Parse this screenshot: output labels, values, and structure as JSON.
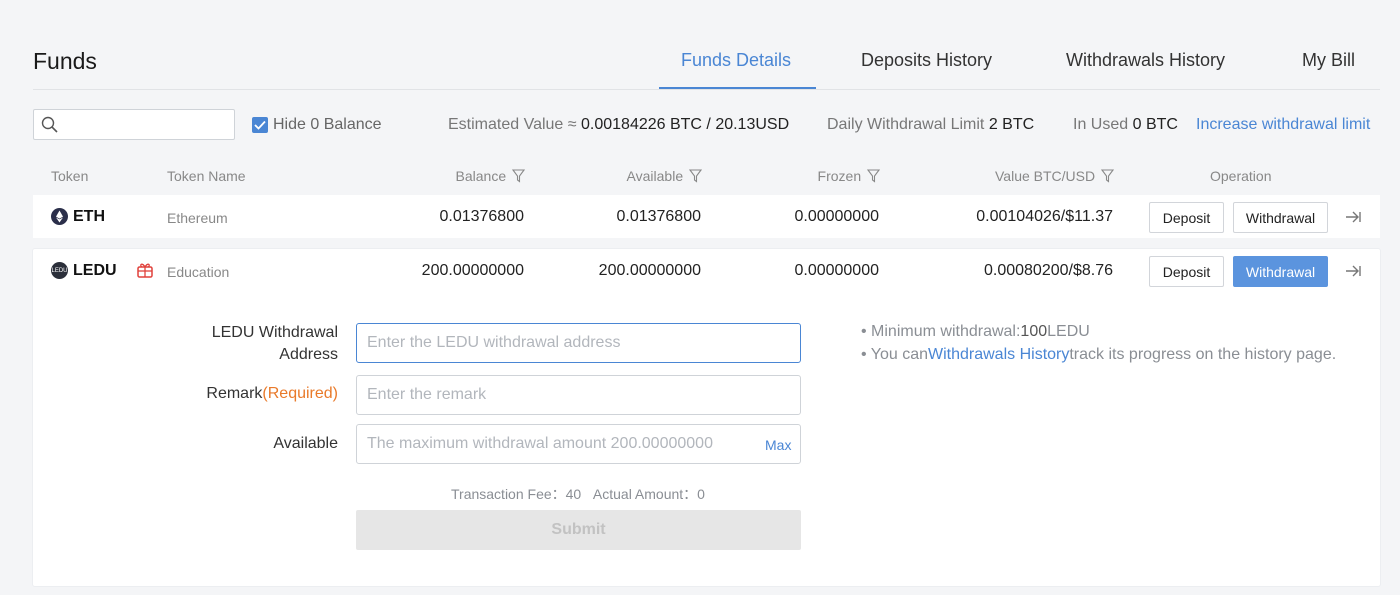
{
  "page": {
    "title": "Funds"
  },
  "tabs": [
    {
      "label": "Funds Details",
      "active": true
    },
    {
      "label": "Deposits History",
      "active": false
    },
    {
      "label": "Withdrawals History",
      "active": false
    },
    {
      "label": "My Bill",
      "active": false
    }
  ],
  "toolbar": {
    "search_value": "",
    "hide_zero_label": "Hide 0 Balance",
    "hide_zero_checked": true,
    "estimated_label": "Estimated Value ≈",
    "estimated_value": "0.00184226 BTC / 20.13USD",
    "daily_limit_label": "Daily Withdrawal Limit",
    "daily_limit_value": "2 BTC",
    "in_used_label": "In Used",
    "in_used_value": "0 BTC",
    "increase_link": "Increase withdrawal limit"
  },
  "table": {
    "headers": {
      "token": "Token",
      "token_name": "Token Name",
      "balance": "Balance",
      "available": "Available",
      "frozen": "Frozen",
      "value": "Value BTC/USD",
      "operation": "Operation"
    },
    "rows": [
      {
        "symbol": "ETH",
        "name": "Ethereum",
        "balance": "0.01376800",
        "available": "0.01376800",
        "frozen": "0.00000000",
        "value": "0.00104026/$11.37",
        "deposit": "Deposit",
        "withdrawal": "Withdrawal"
      },
      {
        "symbol": "LEDU",
        "coin_badge": "LEDU",
        "name": "Education",
        "balance": "200.00000000",
        "available": "200.00000000",
        "frozen": "0.00000000",
        "value": "0.00080200/$8.76",
        "deposit": "Deposit",
        "withdrawal": "Withdrawal"
      }
    ]
  },
  "withdraw_form": {
    "address_label_line1": "LEDU Withdrawal",
    "address_label_line2": "Address",
    "address_placeholder": "Enter the LEDU withdrawal address",
    "remark_label": "Remark",
    "remark_required": "(Required)",
    "remark_placeholder": "Enter the remark",
    "available_label": "Available",
    "available_placeholder": "The maximum withdrawal amount 200.00000000",
    "max_label": "Max",
    "fee_label": "Transaction Fee：",
    "fee_value": "40",
    "actual_label": "Actual Amount：",
    "actual_value": "0",
    "submit_label": "Submit",
    "notes": {
      "min_prefix": "• Minimum withdrawal:",
      "min_amount": "100",
      "min_unit": "LEDU",
      "history_prefix": "• You can",
      "history_link": "Withdrawals History",
      "history_suffix": "track its progress on the history page."
    }
  },
  "colors": {
    "accent": "#4a86d4",
    "required": "#e97a2a",
    "primary_button": "#5b94de"
  }
}
